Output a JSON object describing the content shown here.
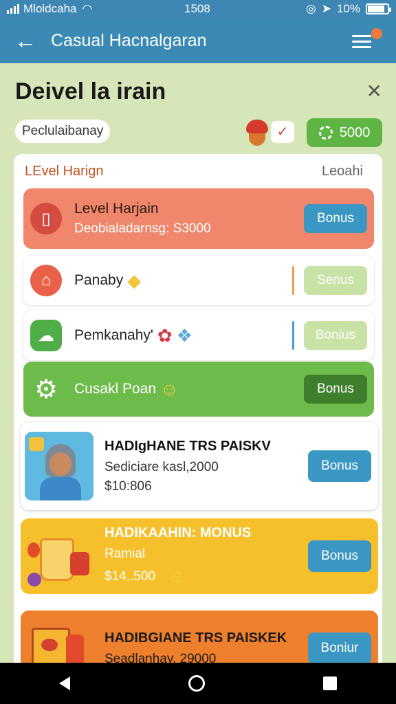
{
  "status": {
    "carrier": "Mloldcaha",
    "time": "1508",
    "battery": "10%"
  },
  "appbar": {
    "title": "Casual Hacnalgaran"
  },
  "header": {
    "title": "Deivel la irain"
  },
  "filters": {
    "chip": "Peclulaibanay",
    "coins": "5000"
  },
  "panel": {
    "left_label": "LEvel Harign",
    "right_label": "Leoahi"
  },
  "rows": [
    {
      "title": "Level Harjain",
      "subtitle": "Deobialadarnsg: S3000",
      "button": "Bonus"
    },
    {
      "title": "Panaby",
      "button": "Senus"
    },
    {
      "title": "Pemkanahy'",
      "button": "Bonius"
    },
    {
      "title": "Cusakl Poan",
      "button": "Bonus"
    }
  ],
  "cards": [
    {
      "title": "HADIgHANE TRS PAISKV",
      "line2": "Sediciare kasl,2000",
      "line3": "$10:806",
      "button": "Bonus"
    },
    {
      "title": "HADIKAAHIN: MONUS",
      "line2": "Ramial",
      "line3": "$14..500",
      "button": "Bonus"
    },
    {
      "title": "HADIBGIANE TRS PAISKEK",
      "line2": "Seadlanhay, 29000",
      "button": "Boniur"
    }
  ],
  "colors": {
    "accent": "#3b8ab5",
    "green": "#6dbb4b",
    "salmon": "#f0866b",
    "yellow": "#f6c02c",
    "orange": "#ee7f2c"
  }
}
